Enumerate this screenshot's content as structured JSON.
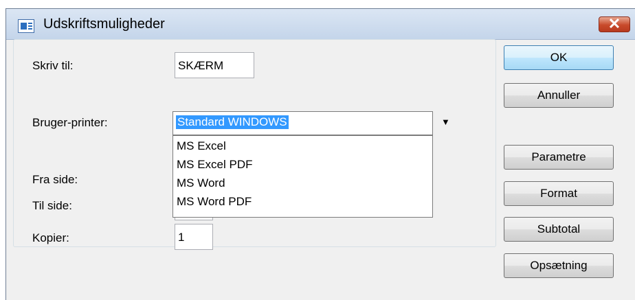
{
  "window": {
    "title": "Udskriftsmuligheder",
    "close_glyph": "✕"
  },
  "form": {
    "skriv_til": {
      "label": "Skriv til:",
      "value": "SKÆRM"
    },
    "bruger_printer": {
      "label": "Bruger-printer:",
      "value": "Standard WINDOWS",
      "arrow_glyph": "▼",
      "options": [
        "MS Excel",
        "MS Excel PDF",
        "MS Word",
        "MS Word PDF"
      ]
    },
    "fra_side": {
      "label": "Fra side:"
    },
    "til_side": {
      "label": "Til side:"
    },
    "kopier": {
      "label": "Kopier:",
      "value": "1"
    }
  },
  "buttons": {
    "ok": "OK",
    "annuller": "Annuller",
    "parametre": "Parametre",
    "format": "Format",
    "subtotal": "Subtotal",
    "opsaetning": "Opsætning"
  },
  "colors": {
    "selection": "#3399ff",
    "titlebar": "#c4d5ea",
    "close_button": "#c84a2b",
    "default_button": "#bee6fd"
  },
  "icons": {
    "app": "app-window-icon",
    "close": "close-icon",
    "dropdown": "chevron-down-icon"
  }
}
